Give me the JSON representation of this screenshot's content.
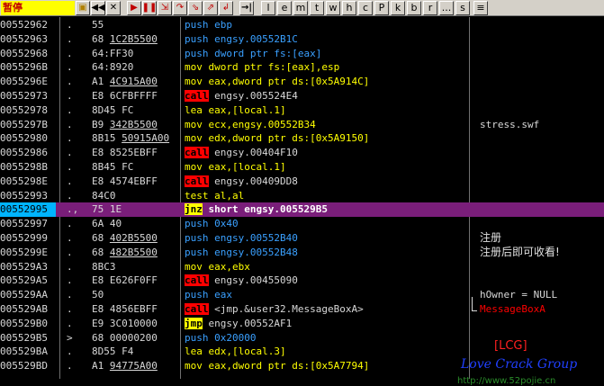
{
  "toolbar": {
    "status_label": "暂停",
    "buttons": [
      {
        "name": "open-file-icon",
        "glyph": "▣",
        "style": "yl"
      },
      {
        "name": "restart-icon",
        "glyph": "◀◀",
        "style": "blk"
      },
      {
        "name": "close-icon",
        "glyph": "✕",
        "style": "blk"
      },
      {
        "name": "run-icon",
        "glyph": "▶",
        "style": "red"
      },
      {
        "name": "pause-icon",
        "glyph": "❚❚",
        "style": "red"
      },
      {
        "name": "step-into-icon",
        "glyph": "⇲",
        "style": "red"
      },
      {
        "name": "step-over-icon",
        "glyph": "↷",
        "style": "red"
      },
      {
        "name": "trace-into-icon",
        "glyph": "⇘",
        "style": "red"
      },
      {
        "name": "trace-over-icon",
        "glyph": "⇗",
        "style": "red"
      },
      {
        "name": "execute-till-return-icon",
        "glyph": "↲",
        "style": "red"
      },
      {
        "name": "goto-icon",
        "glyph": "→|",
        "style": "blk"
      }
    ],
    "letters": [
      "l",
      "e",
      "m",
      "t",
      "w",
      "h",
      "c",
      "P",
      "k",
      "b",
      "r",
      "...",
      "s"
    ],
    "menu_glyph": "≡"
  },
  "rows": [
    {
      "addr": "00552962",
      "mark": ".",
      "hex": "55",
      "hex_ul": "",
      "hex_tail": "",
      "kw": "push",
      "op": "ebp",
      "cmt": "",
      "sel": false
    },
    {
      "addr": "00552963",
      "mark": ".",
      "hex": "68 ",
      "hex_ul": "1C2B5500",
      "hex_tail": "",
      "kw": "push",
      "op": "engsy.00552B1C",
      "cmt": "",
      "sel": false
    },
    {
      "addr": "00552968",
      "mark": ".",
      "hex": "64:FF30",
      "hex_ul": "",
      "hex_tail": "",
      "kw": "push",
      "op": "dword ptr fs:[eax]",
      "cmt": "",
      "sel": false
    },
    {
      "addr": "0055296B",
      "mark": ".",
      "hex": "64:8920",
      "hex_ul": "",
      "hex_tail": "",
      "kw": "mov",
      "op": "dword ptr fs:[eax],esp",
      "cmt": "",
      "sel": false
    },
    {
      "addr": "0055296E",
      "mark": ".",
      "hex": "A1 ",
      "hex_ul": "4C915A00",
      "hex_tail": "",
      "kw": "mov",
      "op": "eax,dword ptr ds:[0x5A914C]",
      "cmt": "",
      "sel": false
    },
    {
      "addr": "00552973",
      "mark": ".",
      "hex": "E8 6CFBFFFF",
      "hex_ul": "",
      "hex_tail": "",
      "kw": "call",
      "op": "engsy.005524E4",
      "cmt": "",
      "sel": false
    },
    {
      "addr": "00552978",
      "mark": ".",
      "hex": "8D45 FC",
      "hex_ul": "",
      "hex_tail": "",
      "kw": "lea",
      "op": "eax,[local.1]",
      "cmt": "",
      "sel": false
    },
    {
      "addr": "0055297B",
      "mark": ".",
      "hex": "B9 ",
      "hex_ul": "342B5500",
      "hex_tail": "",
      "kw": "mov",
      "op": "ecx,engsy.00552B34",
      "cmt": "stress.swf",
      "sel": false
    },
    {
      "addr": "00552980",
      "mark": ".",
      "hex": "8B15 ",
      "hex_ul": "50915A00",
      "hex_tail": "",
      "kw": "mov",
      "op": "edx,dword ptr ds:[0x5A9150]",
      "cmt": "",
      "sel": false
    },
    {
      "addr": "00552986",
      "mark": ".",
      "hex": "E8 8525EBFF",
      "hex_ul": "",
      "hex_tail": "",
      "kw": "call",
      "op": "engsy.00404F10",
      "cmt": "",
      "sel": false
    },
    {
      "addr": "0055298B",
      "mark": ".",
      "hex": "8B45 FC",
      "hex_ul": "",
      "hex_tail": "",
      "kw": "mov",
      "op": "eax,[local.1]",
      "cmt": "",
      "sel": false
    },
    {
      "addr": "0055298E",
      "mark": ".",
      "hex": "E8 4574EBFF",
      "hex_ul": "",
      "hex_tail": "",
      "kw": "call",
      "op": "engsy.00409DD8",
      "cmt": "",
      "sel": false
    },
    {
      "addr": "00552993",
      "mark": ".",
      "hex": "84C0",
      "hex_ul": "",
      "hex_tail": "",
      "kw": "test",
      "op": "al,al",
      "cmt": "",
      "sel": false
    },
    {
      "addr": "00552995",
      "mark": ".,",
      "hex": "75 1E",
      "hex_ul": "",
      "hex_tail": "",
      "kw": "jnz",
      "op": "short engsy.005529B5",
      "cmt": "",
      "sel": true
    },
    {
      "addr": "00552997",
      "mark": ".",
      "hex": "6A 40",
      "hex_ul": "",
      "hex_tail": "",
      "kw": "push",
      "op": "0x40",
      "cmt": "",
      "sel": false
    },
    {
      "addr": "00552999",
      "mark": ".",
      "hex": "68 ",
      "hex_ul": "402B5500",
      "hex_tail": "",
      "kw": "push",
      "op": "engsy.00552B40",
      "cmt": "注册",
      "sel": false
    },
    {
      "addr": "0055299E",
      "mark": ".",
      "hex": "68 ",
      "hex_ul": "482B5500",
      "hex_tail": "",
      "kw": "push",
      "op": "engsy.00552B48",
      "cmt": "注册后即可收看!",
      "sel": false
    },
    {
      "addr": "005529A3",
      "mark": ".",
      "hex": "8BC3",
      "hex_ul": "",
      "hex_tail": "",
      "kw": "mov",
      "op": "eax,ebx",
      "cmt": "",
      "sel": false
    },
    {
      "addr": "005529A5",
      "mark": ".",
      "hex": "E8 E626F0FF",
      "hex_ul": "",
      "hex_tail": "",
      "kw": "call",
      "op": "engsy.00455090",
      "cmt": "",
      "sel": false
    },
    {
      "addr": "005529AA",
      "mark": ".",
      "hex": "50",
      "hex_ul": "",
      "hex_tail": "",
      "kw": "push",
      "op": "eax",
      "cmt": "hOwner = NULL",
      "sel": false
    },
    {
      "addr": "005529AB",
      "mark": ".",
      "hex": "E8 4856EBFF",
      "hex_ul": "",
      "hex_tail": "",
      "kw": "call",
      "op": "<jmp.&user32.MessageBoxA>",
      "cmt": "MessageBoxA",
      "sel": false
    },
    {
      "addr": "005529B0",
      "mark": ".",
      "hex": "E9 3C010000",
      "hex_ul": "",
      "hex_tail": "",
      "kw": "jmp",
      "op": "engsy.00552AF1",
      "cmt": "",
      "sel": false
    },
    {
      "addr": "005529B5",
      "mark": ">",
      "hex": "68 00000200",
      "hex_ul": "",
      "hex_tail": "",
      "kw": "push",
      "op": "0x20000",
      "cmt": "",
      "sel": false
    },
    {
      "addr": "005529BA",
      "mark": ".",
      "hex": "8D55 F4",
      "hex_ul": "",
      "hex_tail": "",
      "kw": "lea",
      "op": "edx,[local.3]",
      "cmt": "",
      "sel": false
    },
    {
      "addr": "005529BD",
      "mark": ".",
      "hex": "A1 ",
      "hex_ul": "94775A00",
      "hex_tail": "",
      "kw": "mov",
      "op": "eax,dword ptr ds:[0x5A7794]",
      "cmt": "",
      "sel": false
    }
  ],
  "watermark": {
    "lcg": "[LCG]",
    "title": "Love Crack Group",
    "url": "http://www.52pojie.cn"
  }
}
